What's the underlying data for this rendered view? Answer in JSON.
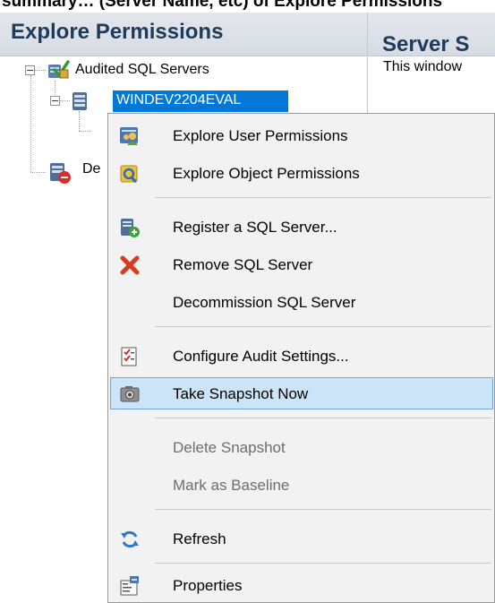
{
  "caption_partial": "summary… (Server Name, etc) of Explore Permissions",
  "left_pane": {
    "title": "Explore Permissions"
  },
  "right_pane": {
    "title": "Server S",
    "description": "This window"
  },
  "tree": {
    "root_label": "Audited SQL Servers",
    "server_label": "WINDEV2204EVAL",
    "second_label": "De"
  },
  "context_menu": {
    "items": [
      {
        "label": "Explore User Permissions",
        "icon": "user-permissions-icon",
        "enabled": true
      },
      {
        "label": "Explore Object Permissions",
        "icon": "object-permissions-icon",
        "enabled": true
      },
      {
        "label": "Register a SQL Server...",
        "icon": "register-server-icon",
        "enabled": true
      },
      {
        "label": "Remove SQL Server",
        "icon": "remove-x-icon",
        "enabled": true
      },
      {
        "label": "Decommission SQL Server",
        "icon": "",
        "enabled": true
      },
      {
        "label": "Configure Audit Settings...",
        "icon": "audit-checklist-icon",
        "enabled": true
      },
      {
        "label": "Take Snapshot Now",
        "icon": "camera-icon",
        "enabled": true,
        "highlighted": true
      },
      {
        "label": "Delete Snapshot",
        "icon": "",
        "enabled": false
      },
      {
        "label": "Mark as Baseline",
        "icon": "",
        "enabled": false
      },
      {
        "label": "Refresh",
        "icon": "refresh-icon",
        "enabled": true
      },
      {
        "label": "Properties",
        "icon": "properties-icon",
        "enabled": true
      }
    ]
  },
  "colors": {
    "selection": "#0078d7",
    "menu_highlight": "#cce4f7",
    "header_text": "#1f3b5a"
  }
}
